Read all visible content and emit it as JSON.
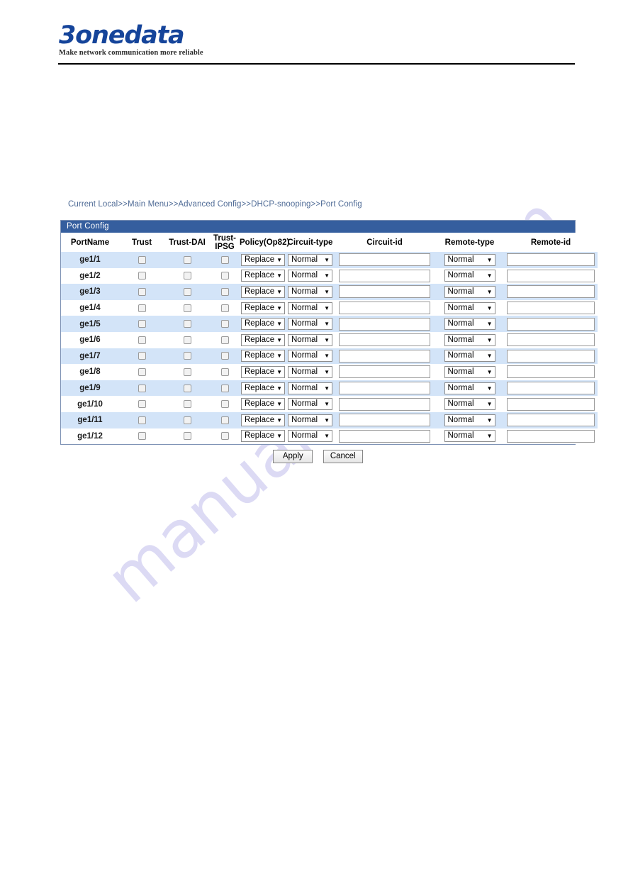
{
  "brand": {
    "logo_text": "3onedata",
    "tagline": "Make network communication more reliable",
    "logo_color": "#15449a"
  },
  "watermark": {
    "text": "manualshive.com",
    "color": "#cfcdf0"
  },
  "breadcrumb": {
    "text": "Current Local>>Main Menu>>Advanced Config>>DHCP-snooping>>Port Config"
  },
  "panel": {
    "title": "Port Config",
    "title_bar_color": "#355e9e",
    "row_highlight_color": "#d3e4f8",
    "columns": [
      "PortName",
      "Trust",
      "Trust-DAI",
      "Trust-IPSG",
      "Policy(Op82)",
      "Circuit-type",
      "Circuit-id",
      "Remote-type",
      "Remote-id"
    ],
    "column_ipsg_line1": "Trust-",
    "column_ipsg_line2": "IPSG",
    "rows": [
      {
        "port": "ge1/1",
        "trust": false,
        "trust_dai": false,
        "trust_ipsg": false,
        "policy": "Replace",
        "circuit_type": "Normal",
        "circuit_id": "",
        "remote_type": "Normal",
        "remote_id": ""
      },
      {
        "port": "ge1/2",
        "trust": false,
        "trust_dai": false,
        "trust_ipsg": false,
        "policy": "Replace",
        "circuit_type": "Normal",
        "circuit_id": "",
        "remote_type": "Normal",
        "remote_id": ""
      },
      {
        "port": "ge1/3",
        "trust": false,
        "trust_dai": false,
        "trust_ipsg": false,
        "policy": "Replace",
        "circuit_type": "Normal",
        "circuit_id": "",
        "remote_type": "Normal",
        "remote_id": ""
      },
      {
        "port": "ge1/4",
        "trust": false,
        "trust_dai": false,
        "trust_ipsg": false,
        "policy": "Replace",
        "circuit_type": "Normal",
        "circuit_id": "",
        "remote_type": "Normal",
        "remote_id": ""
      },
      {
        "port": "ge1/5",
        "trust": false,
        "trust_dai": false,
        "trust_ipsg": false,
        "policy": "Replace",
        "circuit_type": "Normal",
        "circuit_id": "",
        "remote_type": "Normal",
        "remote_id": ""
      },
      {
        "port": "ge1/6",
        "trust": false,
        "trust_dai": false,
        "trust_ipsg": false,
        "policy": "Replace",
        "circuit_type": "Normal",
        "circuit_id": "",
        "remote_type": "Normal",
        "remote_id": ""
      },
      {
        "port": "ge1/7",
        "trust": false,
        "trust_dai": false,
        "trust_ipsg": false,
        "policy": "Replace",
        "circuit_type": "Normal",
        "circuit_id": "",
        "remote_type": "Normal",
        "remote_id": ""
      },
      {
        "port": "ge1/8",
        "trust": false,
        "trust_dai": false,
        "trust_ipsg": false,
        "policy": "Replace",
        "circuit_type": "Normal",
        "circuit_id": "",
        "remote_type": "Normal",
        "remote_id": ""
      },
      {
        "port": "ge1/9",
        "trust": false,
        "trust_dai": false,
        "trust_ipsg": false,
        "policy": "Replace",
        "circuit_type": "Normal",
        "circuit_id": "",
        "remote_type": "Normal",
        "remote_id": ""
      },
      {
        "port": "ge1/10",
        "trust": false,
        "trust_dai": false,
        "trust_ipsg": false,
        "policy": "Replace",
        "circuit_type": "Normal",
        "circuit_id": "",
        "remote_type": "Normal",
        "remote_id": ""
      },
      {
        "port": "ge1/11",
        "trust": false,
        "trust_dai": false,
        "trust_ipsg": false,
        "policy": "Replace",
        "circuit_type": "Normal",
        "circuit_id": "",
        "remote_type": "Normal",
        "remote_id": ""
      },
      {
        "port": "ge1/12",
        "trust": false,
        "trust_dai": false,
        "trust_ipsg": false,
        "policy": "Replace",
        "circuit_type": "Normal",
        "circuit_id": "",
        "remote_type": "Normal",
        "remote_id": ""
      }
    ]
  },
  "buttons": {
    "apply_label": "Apply",
    "cancel_label": "Cancel"
  },
  "icons": {
    "chevron_down": "▼"
  }
}
